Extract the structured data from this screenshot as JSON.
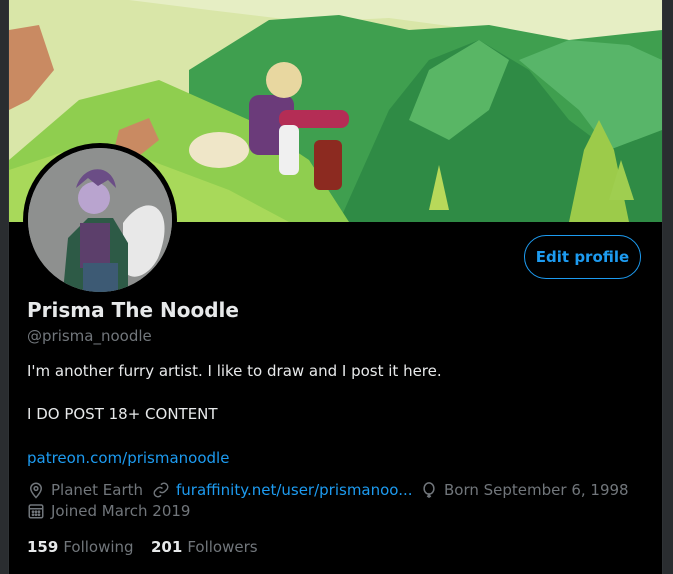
{
  "profile": {
    "name": "Prisma The Noodle",
    "handle": "@prisma_noodle",
    "bio_line1": "I'm another furry artist. I like to draw and I post it here.",
    "bio_line2": "I DO POST 18+ CONTENT",
    "bio_link": "patreon.com/prismanoodle",
    "location": "Planet Earth",
    "website": "furaffinity.net/user/prismanoo...",
    "birthday": "Born September 6, 1998",
    "joined": "Joined March 2019"
  },
  "actions": {
    "edit_profile": "Edit profile"
  },
  "stats": {
    "following_count": "159",
    "following_label": "Following",
    "followers_count": "201",
    "followers_label": "Followers"
  },
  "icons": [
    "location-icon",
    "link-icon",
    "balloon-icon",
    "calendar-icon"
  ],
  "colors": {
    "accent": "#1d9bf0",
    "background": "#000000",
    "muted": "#71767b",
    "text": "#e7e9ea"
  }
}
